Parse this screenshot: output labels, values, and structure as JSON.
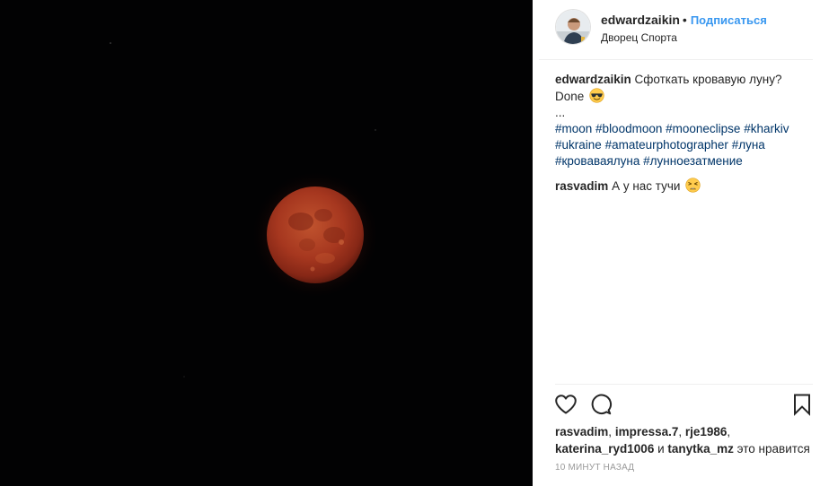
{
  "post": {
    "username": "edwardzaikin",
    "separator": "•",
    "follow_label": "Подписаться",
    "location": "Дворец Спорта"
  },
  "caption": {
    "username": "edwardzaikin",
    "text_line1": "Сфоткать кровавую луну?",
    "text_line2": "Done",
    "ellipsis": "...",
    "hashtags": [
      "#moon",
      "#bloodmoon",
      "#mooneclipse",
      "#kharkiv",
      "#ukraine",
      "#amateurphotographer",
      "#луна",
      "#кроваваялуна",
      "#лунноезатмение"
    ]
  },
  "comment": {
    "username": "rasvadim",
    "text": "А у нас тучи"
  },
  "likes": {
    "users": [
      "rasvadim",
      "impressa.7",
      "rje1986",
      "katerina_ryd1006",
      "tanytka_mz"
    ],
    "sep1": ", ",
    "conjunction": " и ",
    "suffix": " это нравится"
  },
  "timestamp": "10 МИНУТ НАЗАД",
  "icons": {
    "like": "heart-icon",
    "comment": "comment-icon",
    "save": "bookmark-icon",
    "caption_emoji": "sunglasses-emoji",
    "comment_emoji": "tired-face-emoji"
  },
  "colors": {
    "link": "#3897f0",
    "hashtag": "#003569",
    "text": "#262626",
    "muted": "#999999",
    "photo_bg": "#020203",
    "moon": "#a3331d"
  }
}
